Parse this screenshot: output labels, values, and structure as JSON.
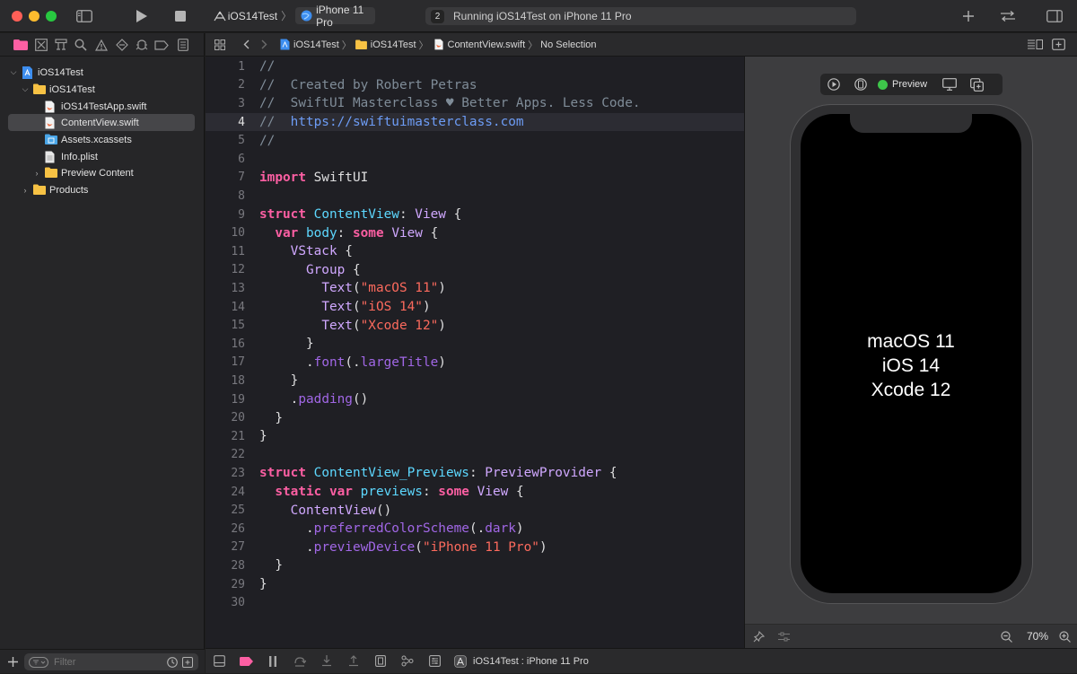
{
  "toolbar": {
    "scheme_project": "iOS14Test",
    "scheme_device": "iPhone 11 Pro",
    "activity_badge": "2",
    "activity_text": "Running iOS14Test on iPhone 11 Pro"
  },
  "navigator": {
    "items": [
      {
        "label": "iOS14Test"
      },
      {
        "label": "iOS14Test"
      },
      {
        "label": "iOS14TestApp.swift"
      },
      {
        "label": "ContentView.swift"
      },
      {
        "label": "Assets.xcassets"
      },
      {
        "label": "Info.plist"
      },
      {
        "label": "Preview Content"
      },
      {
        "label": "Products"
      }
    ],
    "filter_placeholder": "Filter"
  },
  "jumpbar": {
    "project": "iOS14Test",
    "group": "iOS14Test",
    "file": "ContentView.swift",
    "selection": "No Selection"
  },
  "editor": {
    "current_line": 4,
    "lines": [
      {
        "n": "1",
        "html": "<span class='t-com'>//</span>"
      },
      {
        "n": "2",
        "html": "<span class='t-com'>//  Created by Robert Petras</span>"
      },
      {
        "n": "3",
        "html": "<span class='t-com'>//  SwiftUI Masterclass ♥ Better Apps. Less Code.</span>"
      },
      {
        "n": "4",
        "html": "<span class='t-com'>//  </span><span class='t-url'>https://swiftuimasterclass.com</span>"
      },
      {
        "n": "5",
        "html": "<span class='t-com'>//</span>"
      },
      {
        "n": "6",
        "html": ""
      },
      {
        "n": "7",
        "html": "<span class='t-kw'>import</span> SwiftUI"
      },
      {
        "n": "8",
        "html": ""
      },
      {
        "n": "9",
        "html": "<span class='t-kw'>struct</span> <span class='t-type'>ContentView</span>: <span class='t-sys'>View</span> {"
      },
      {
        "n": "10",
        "html": "  <span class='t-kw'>var</span> <span class='t-type'>body</span>: <span class='t-kw'>some</span> <span class='t-sys'>View</span> {"
      },
      {
        "n": "11",
        "html": "    <span class='t-sys'>VStack</span> {"
      },
      {
        "n": "12",
        "html": "      <span class='t-sys'>Group</span> {"
      },
      {
        "n": "13",
        "html": "        <span class='t-sys'>Text</span>(<span class='t-str'>\"macOS 11\"</span>)"
      },
      {
        "n": "14",
        "html": "        <span class='t-sys'>Text</span>(<span class='t-str'>\"iOS 14\"</span>)"
      },
      {
        "n": "15",
        "html": "        <span class='t-sys'>Text</span>(<span class='t-str'>\"Xcode 12\"</span>)"
      },
      {
        "n": "16",
        "html": "      }"
      },
      {
        "n": "17",
        "html": "      .<span class='t-prop'>font</span>(.<span class='t-prop'>largeTitle</span>)"
      },
      {
        "n": "18",
        "html": "    }"
      },
      {
        "n": "19",
        "html": "    .<span class='t-prop'>padding</span>()"
      },
      {
        "n": "20",
        "html": "  }"
      },
      {
        "n": "21",
        "html": "}"
      },
      {
        "n": "22",
        "html": ""
      },
      {
        "n": "23",
        "html": "<span class='t-kw'>struct</span> <span class='t-type'>ContentView_Previews</span>: <span class='t-sys'>PreviewProvider</span> {"
      },
      {
        "n": "24",
        "html": "  <span class='t-kw'>static</span> <span class='t-kw'>var</span> <span class='t-type'>previews</span>: <span class='t-kw'>some</span> <span class='t-sys'>View</span> {"
      },
      {
        "n": "25",
        "html": "    <span class='t-sys'>ContentView</span>()"
      },
      {
        "n": "26",
        "html": "      .<span class='t-prop'>preferredColorScheme</span>(.<span class='t-prop'>dark</span>)"
      },
      {
        "n": "27",
        "html": "      .<span class='t-prop'>previewDevice</span>(<span class='t-str'>\"iPhone 11 Pro\"</span>)"
      },
      {
        "n": "28",
        "html": "  }"
      },
      {
        "n": "29",
        "html": "}"
      },
      {
        "n": "30",
        "html": ""
      }
    ]
  },
  "canvas": {
    "preview_label": "Preview",
    "preview_status_color": "#3ec54a",
    "preview_lines": [
      "macOS 11",
      "iOS 14",
      "Xcode 12"
    ],
    "zoom": "70%"
  },
  "debugbar": {
    "target": "iOS14Test : iPhone 11 Pro"
  },
  "colors": {
    "close": "#ff5f57",
    "minimize": "#febc2e",
    "zoom": "#28c840",
    "breakpoint": "#fc5fa3",
    "folder": "#f7c244",
    "swift_file": "#f0673a",
    "project_icon": "#3d8ef0"
  }
}
